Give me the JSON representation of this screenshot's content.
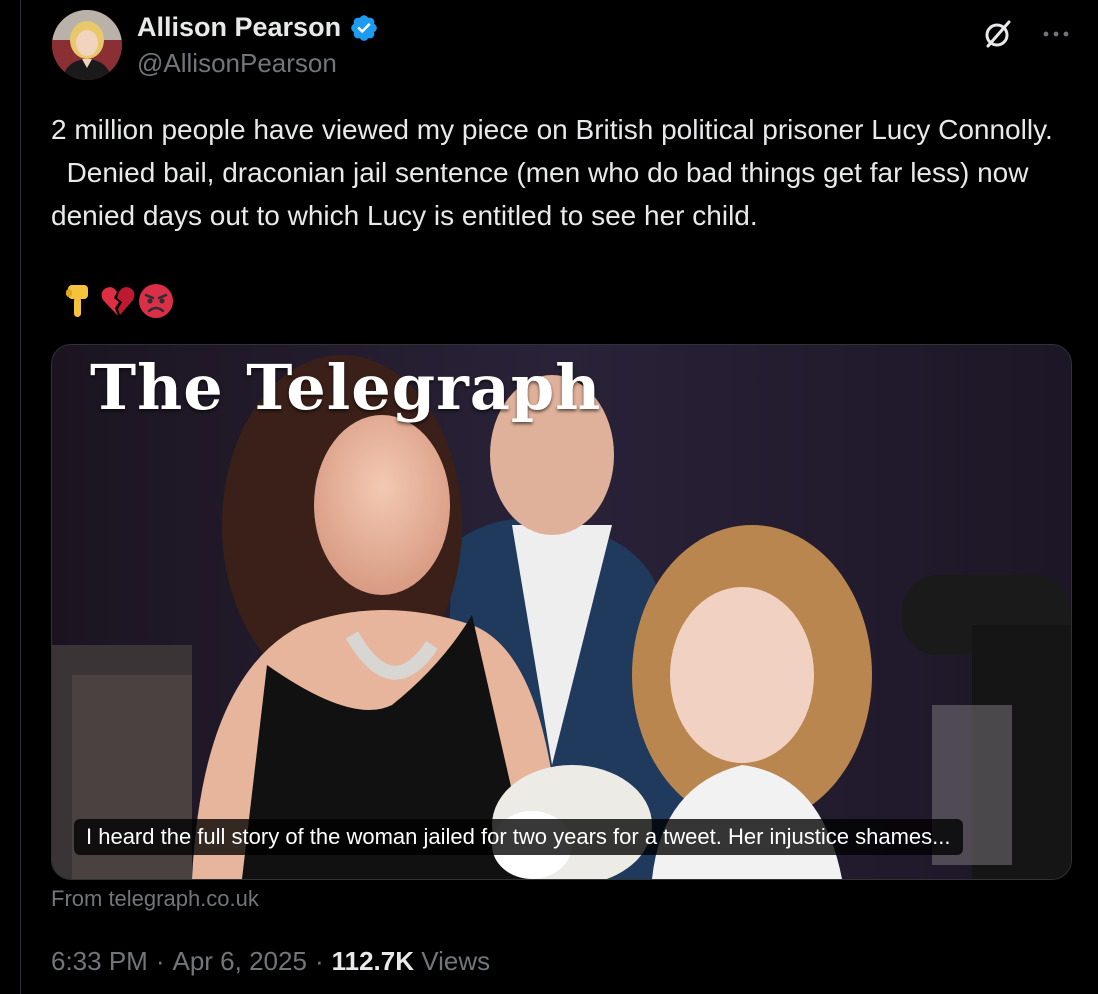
{
  "author": {
    "display_name": "Allison Pearson",
    "handle": "@AllisonPearson",
    "verified": true,
    "verified_color": "#1d9bf0"
  },
  "tweet": {
    "text": "2 million people have viewed my piece on British political prisoner Lucy Connolly.\n  Denied bail, draconian jail sentence (men who do bad things get far less) now denied days out to which Lucy is entitled to see her child.",
    "emojis": [
      "backhand-index-pointing-down",
      "broken-heart",
      "pouting-face"
    ]
  },
  "card": {
    "masthead": "The Telegraph",
    "caption": "I heard the full story of the woman jailed for two years for a tweet. Her injustice shames...",
    "source": "From telegraph.co.uk"
  },
  "meta": {
    "time": "6:33 PM",
    "separator": "·",
    "date": "Apr 6, 2025",
    "views_count": "112.7K",
    "views_label": "Views"
  },
  "icons": {
    "grok": "grok-icon",
    "more": "more-icon"
  },
  "colors": {
    "background": "#000000",
    "text_primary": "#e7e9ea",
    "text_secondary": "#71767b",
    "border": "#2f3336",
    "accent": "#1d9bf0"
  }
}
